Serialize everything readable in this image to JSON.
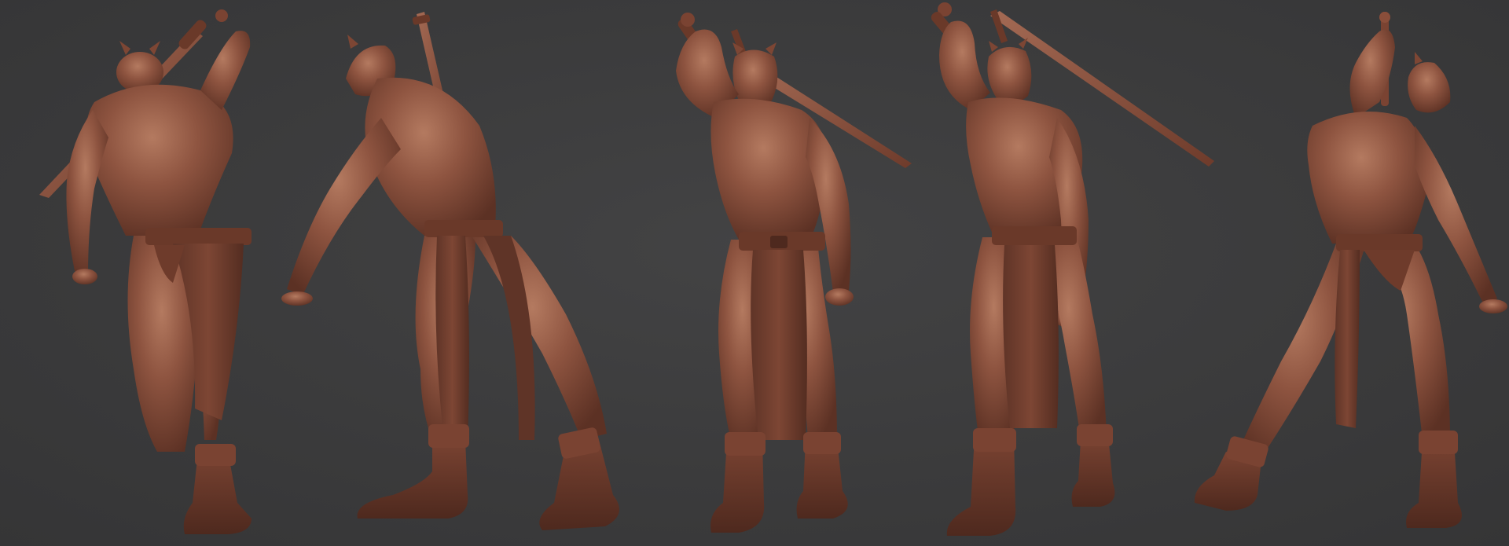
{
  "scene": {
    "background_color": "#3a3a3b",
    "material_color": "#8a4e3a",
    "material_shadow": "#5a2f22",
    "material_highlight": "#b0735a",
    "views": [
      {
        "id": "back",
        "icon": "sculpt-back-view"
      },
      {
        "id": "back-three-quarter",
        "icon": "sculpt-back-three-quarter-view"
      },
      {
        "id": "front",
        "icon": "sculpt-front-view"
      },
      {
        "id": "front-three-quarter",
        "icon": "sculpt-front-three-quarter-view"
      },
      {
        "id": "side-rear",
        "icon": "sculpt-side-rear-view"
      }
    ]
  }
}
